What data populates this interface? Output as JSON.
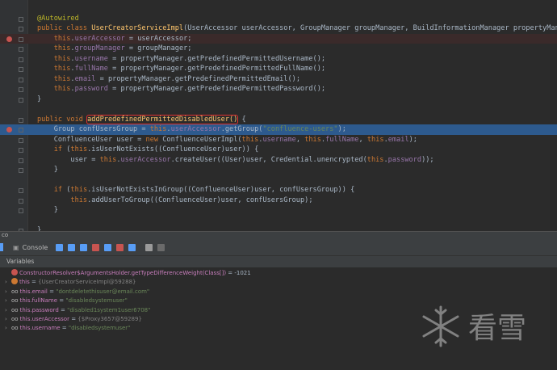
{
  "editor": {
    "lines": [
      {
        "parts": []
      },
      {
        "parts": [
          {
            "t": "@Autowired",
            "c": "ann"
          }
        ]
      },
      {
        "parts": [
          {
            "t": "public class ",
            "c": "kw"
          },
          {
            "t": "UserCreatorServiceImpl",
            "c": "mth"
          },
          {
            "t": "(UserAccessor userAccessor, GroupManager groupManager, BuildInformationManager propertyManager) {"
          }
        ]
      },
      {
        "parts": [
          {
            "t": "    "
          },
          {
            "t": "this",
            "c": "kw"
          },
          {
            "t": "."
          },
          {
            "t": "userAccessor",
            "c": "fld"
          },
          {
            "t": " = userAccessor;"
          }
        ],
        "err": true,
        "bp": true
      },
      {
        "parts": [
          {
            "t": "    "
          },
          {
            "t": "this",
            "c": "kw"
          },
          {
            "t": "."
          },
          {
            "t": "groupManager",
            "c": "fld"
          },
          {
            "t": " = groupManager;"
          }
        ]
      },
      {
        "parts": [
          {
            "t": "    "
          },
          {
            "t": "this",
            "c": "kw"
          },
          {
            "t": "."
          },
          {
            "t": "username",
            "c": "fld"
          },
          {
            "t": " = propertyManager.getPredefinedPermittedUsername();"
          }
        ]
      },
      {
        "parts": [
          {
            "t": "    "
          },
          {
            "t": "this",
            "c": "kw"
          },
          {
            "t": "."
          },
          {
            "t": "fullName",
            "c": "fld"
          },
          {
            "t": " = propertyManager.getPredefinedPermittedFullName();"
          }
        ]
      },
      {
        "parts": [
          {
            "t": "    "
          },
          {
            "t": "this",
            "c": "kw"
          },
          {
            "t": "."
          },
          {
            "t": "email",
            "c": "fld"
          },
          {
            "t": " = propertyManager.getPredefinedPermittedEmail();"
          }
        ]
      },
      {
        "parts": [
          {
            "t": "    "
          },
          {
            "t": "this",
            "c": "kw"
          },
          {
            "t": "."
          },
          {
            "t": "password",
            "c": "fld"
          },
          {
            "t": " = propertyManager.getPredefinedPermittedPassword();"
          }
        ]
      },
      {
        "parts": [
          {
            "t": "}"
          }
        ]
      },
      {
        "parts": []
      },
      {
        "parts": [
          {
            "t": "public void ",
            "c": "kw"
          },
          {
            "t": "addPredefinedPermittedDisabledUser()",
            "c": "hl"
          },
          {
            "t": " {"
          }
        ]
      },
      {
        "parts": [
          {
            "t": "    Group confUsersGroup = "
          },
          {
            "t": "this",
            "c": "kw"
          },
          {
            "t": "."
          },
          {
            "t": "userAccessor",
            "c": "fld"
          },
          {
            "t": ".getGroup("
          },
          {
            "t": "\"confluence-users\"",
            "c": "str"
          },
          {
            "t": ");"
          }
        ],
        "sel": true,
        "bp": true
      },
      {
        "parts": [
          {
            "t": "    ConfluenceUser user = "
          },
          {
            "t": "new ",
            "c": "kw"
          },
          {
            "t": "ConfluenceUserImpl("
          },
          {
            "t": "this",
            "c": "kw"
          },
          {
            "t": "."
          },
          {
            "t": "username",
            "c": "fld"
          },
          {
            "t": ", "
          },
          {
            "t": "this",
            "c": "kw"
          },
          {
            "t": "."
          },
          {
            "t": "fullName",
            "c": "fld"
          },
          {
            "t": ", "
          },
          {
            "t": "this",
            "c": "kw"
          },
          {
            "t": "."
          },
          {
            "t": "email",
            "c": "fld"
          },
          {
            "t": ");"
          }
        ]
      },
      {
        "parts": [
          {
            "t": "    "
          },
          {
            "t": "if ",
            "c": "kw"
          },
          {
            "t": "("
          },
          {
            "t": "this",
            "c": "kw"
          },
          {
            "t": ".isUserNotExists((ConfluenceUser)user)) {"
          }
        ]
      },
      {
        "parts": [
          {
            "t": "        user = "
          },
          {
            "t": "this",
            "c": "kw"
          },
          {
            "t": "."
          },
          {
            "t": "userAccessor",
            "c": "fld"
          },
          {
            "t": ".createUser((User)user, Credential.unencrypted("
          },
          {
            "t": "this",
            "c": "kw"
          },
          {
            "t": "."
          },
          {
            "t": "password",
            "c": "fld"
          },
          {
            "t": "));"
          }
        ]
      },
      {
        "parts": [
          {
            "t": "    }"
          }
        ]
      },
      {
        "parts": []
      },
      {
        "parts": [
          {
            "t": "    "
          },
          {
            "t": "if ",
            "c": "kw"
          },
          {
            "t": "("
          },
          {
            "t": "this",
            "c": "kw"
          },
          {
            "t": ".isUserNotExistsInGroup((ConfluenceUser)user, confUsersGroup)) {"
          }
        ]
      },
      {
        "parts": [
          {
            "t": "        "
          },
          {
            "t": "this",
            "c": "kw"
          },
          {
            "t": ".addUserToGroup((ConfluenceUser)user, confUsersGroup);"
          }
        ]
      },
      {
        "parts": [
          {
            "t": "    }"
          }
        ]
      },
      {
        "parts": []
      },
      {
        "parts": [
          {
            "t": "}"
          }
        ]
      }
    ]
  },
  "debug": {
    "session_label": "co",
    "console_tab": "Console",
    "variables_header": "Variables",
    "variables": [
      {
        "prefix": "",
        "name": "ConstructorResolver$ArgumentsHolder.getTypeDifferenceWeight(Class[])",
        "op": " = ",
        "value": "-1021",
        "kind": "plain",
        "icon": "#c75450",
        "expand": false
      },
      {
        "prefix": "",
        "name": "this",
        "op": " = ",
        "value": "{UserCreatorServiceImpl@59288}",
        "kind": "ref",
        "icon": "#cc7832",
        "expand": true
      },
      {
        "prefix": "oo",
        "name": "this.email",
        "op": " = ",
        "value": "\"dontdeletethisuser@email.com\"",
        "kind": "str",
        "icon": "",
        "expand": true
      },
      {
        "prefix": "oo",
        "name": "this.fullName",
        "op": " = ",
        "value": "\"disabledsystemuser\"",
        "kind": "str",
        "icon": "",
        "expand": true
      },
      {
        "prefix": "oo",
        "name": "this.password",
        "op": " = ",
        "value": "\"disabled1system1user6708\"",
        "kind": "str",
        "icon": "",
        "expand": true
      },
      {
        "prefix": "oo",
        "name": "this.userAccessor",
        "op": " = ",
        "value": "{$Proxy3657@59289}",
        "kind": "ref",
        "icon": "",
        "expand": true
      },
      {
        "prefix": "oo",
        "name": "this.username",
        "op": " = ",
        "value": "\"disabledsystemuser\"",
        "kind": "str",
        "icon": "",
        "expand": true
      }
    ]
  },
  "watermark": {
    "text": "看雪"
  },
  "colors": {
    "selection": "#2d5a8e",
    "error": "#c75450",
    "keyword": "#cc7832"
  }
}
